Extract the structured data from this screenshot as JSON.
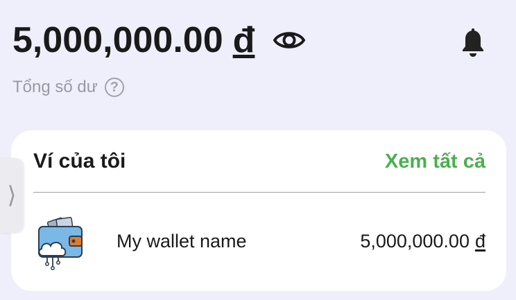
{
  "header": {
    "balance": "5,000,000.00",
    "currency": "đ",
    "total_label": "Tổng số dư",
    "help_symbol": "?"
  },
  "icons": {
    "visibility": "eye-icon",
    "notifications": "bell-icon",
    "help": "question-circle-icon",
    "side_handle": "chevron-right-icon",
    "wallet": "cloud-wallet-icon"
  },
  "side_handle": {
    "glyph": "⟩"
  },
  "wallet_card": {
    "title": "Ví của tôi",
    "view_all": "Xem tất cả",
    "items": [
      {
        "name": "My wallet name",
        "balance": "5,000,000.00",
        "currency": "đ"
      }
    ]
  },
  "colors": {
    "background": "#efeefb",
    "accent_green": "#4caf50",
    "text_primary": "#1a1a1a",
    "text_muted": "#9a9aa2"
  }
}
